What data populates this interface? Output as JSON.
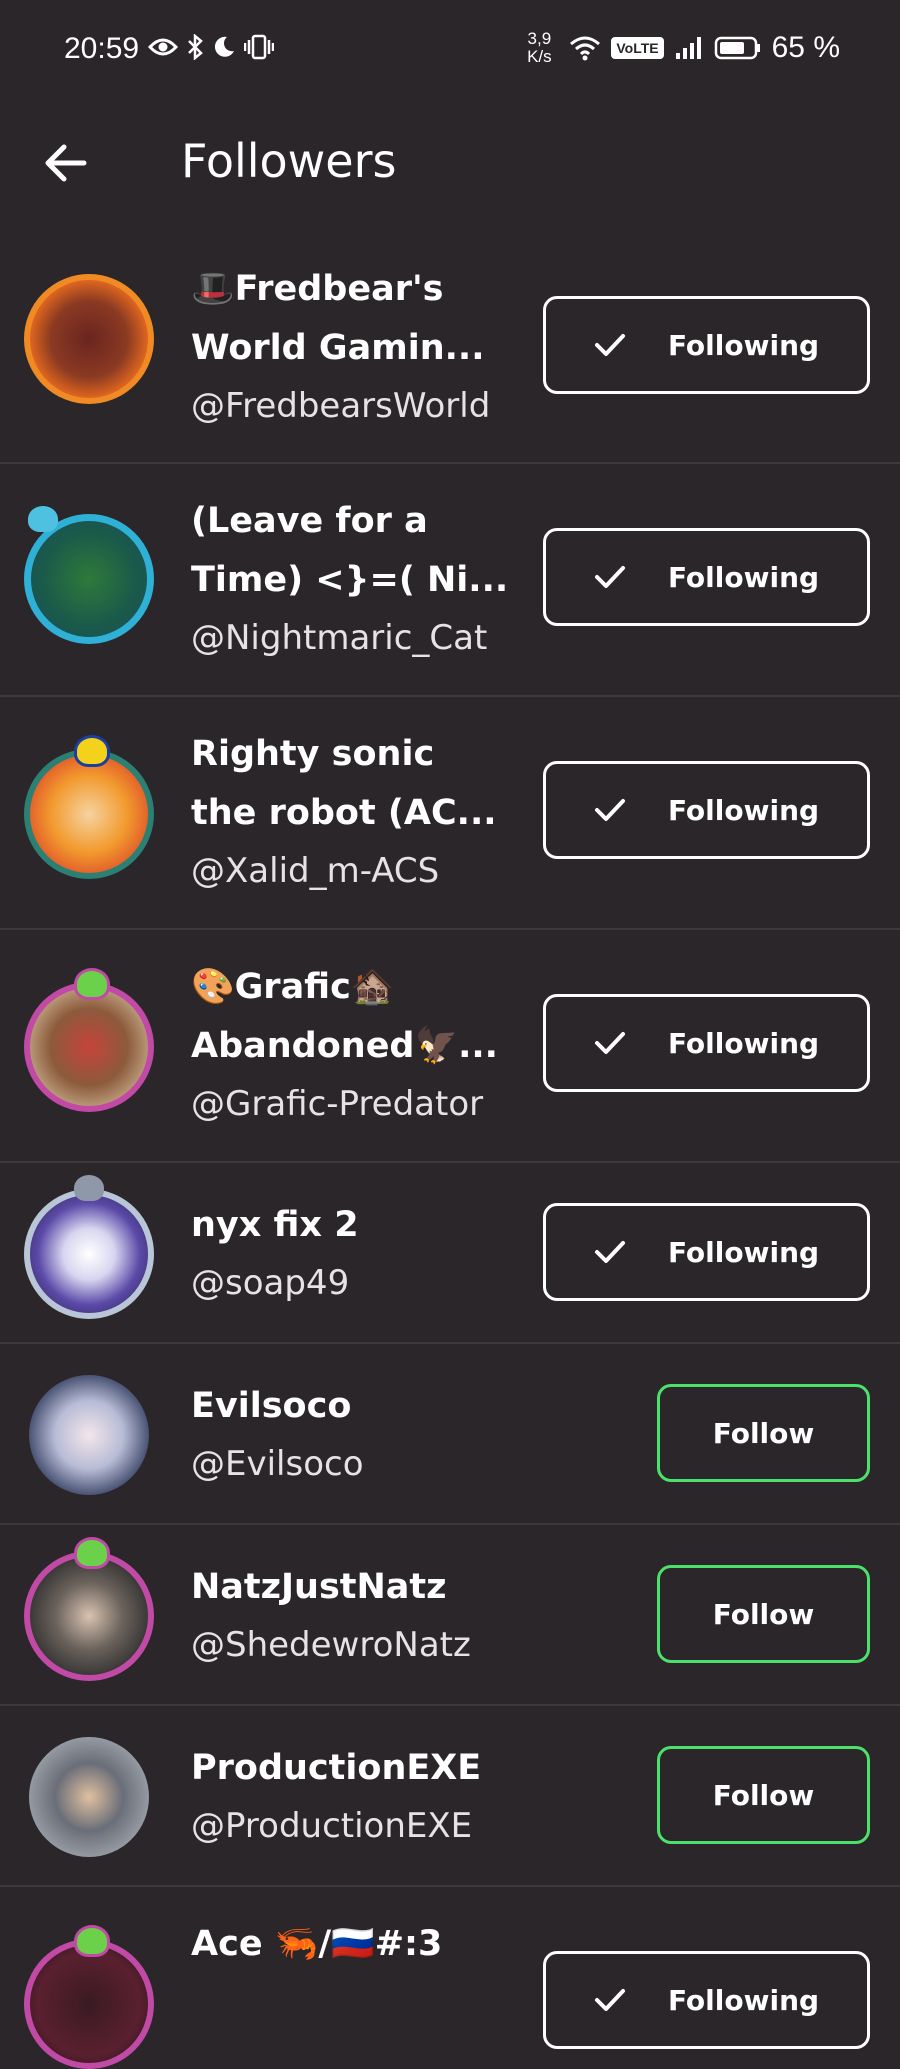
{
  "status_bar": {
    "time": "20:59",
    "net_speed_value": "3,9",
    "net_speed_unit": "K/s",
    "volte": "VoLTE",
    "battery_percent": "65 %"
  },
  "header": {
    "title": "Followers"
  },
  "followers": [
    {
      "name": "🎩Fredbear's World Gamin...",
      "handle": "@FredbearsWorld",
      "button": "Following",
      "state": "following"
    },
    {
      "name": "(Leave for a Time) <}=( Ni...",
      "handle": "@Nightmaric_Cat",
      "button": "Following",
      "state": "following"
    },
    {
      "name": "Righty sonic the robot (AC...",
      "handle": "@Xalid_m-ACS",
      "button": "Following",
      "state": "following"
    },
    {
      "name": "🎨Grafic🏚️ Abandoned🦅...",
      "handle": "@Grafic-Predator",
      "button": "Following",
      "state": "following"
    },
    {
      "name": "nyx fix 2",
      "handle": "@soap49",
      "button": "Following",
      "state": "following"
    },
    {
      "name": "Evilsoco",
      "handle": "@Evilsoco",
      "button": "Follow",
      "state": "follow"
    },
    {
      "name": "NatzJustNatz",
      "handle": "@ShedewroNatz",
      "button": "Follow",
      "state": "follow"
    },
    {
      "name": "ProductionEXE",
      "handle": "@ProductionEXE",
      "button": "Follow",
      "state": "follow"
    },
    {
      "name": "Ace 🦐/🇷🇺#:3",
      "handle": "",
      "button": "Following",
      "state": "following"
    }
  ],
  "colors": {
    "background": "#2b2629",
    "follow_accent": "#4ce16b",
    "divider": "#3d383b"
  }
}
